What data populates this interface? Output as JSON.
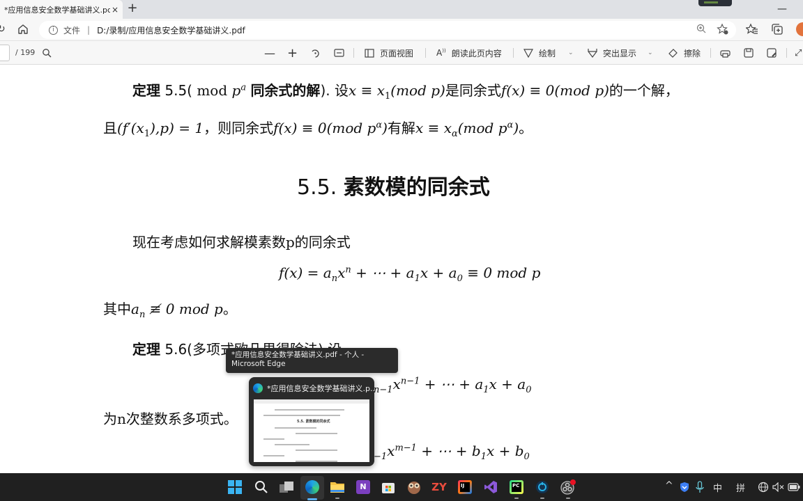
{
  "browser": {
    "tab_title": "*应用信息安全数学基础讲义.pdf",
    "tab_close": "×",
    "new_tab": "+",
    "minimize": "—",
    "address": {
      "scheme_label": "文件",
      "separator": "|",
      "url": "D:/录制/应用信息安全数学基础讲义.pdf"
    }
  },
  "pdf_toolbar": {
    "page_current": "",
    "page_total": "/ 199",
    "page_view": "页面视图",
    "read_aloud": "朗读此页内容",
    "draw": "绘制",
    "highlight": "突出显示",
    "erase": "擦除"
  },
  "document": {
    "theorem55": {
      "label": "定理",
      "number": "5.5(",
      "mod": "mod",
      "p": "p",
      "a": "a",
      "title_rest": "同余式的解",
      "close": ").",
      "line1_a": "设",
      "line1_b": "是同余式",
      "line1_c": "的一个解，",
      "line2_a": "且",
      "line2_b": "，则同余式",
      "line2_c": "有解",
      "line2_d": "。"
    },
    "heading": {
      "number": "5.5.",
      "title": "素数模的同余式"
    },
    "intro": "现在考虑如何求解模素数p的同余式",
    "where_a": "其中",
    "where_b": "。",
    "theorem56": {
      "label": "定理",
      "rest": "5.6(多项式欧几里得除法) 设"
    },
    "poly_desc": "为n次整数系多项式。",
    "math": {
      "eq1": "x ≡ x",
      "sub1": "1",
      "mod_p": "(mod  p)",
      "fx0": "f(x) ≡ 0(mod  p)",
      "gcd": "(f′(x",
      "gcd_rest": "),p) = 1",
      "fx0a": "f(x) ≡ 0(mod  p",
      "alpha": "α",
      "sol": "x ≡ x",
      "sol_mod": "(mod  p",
      "close": ")",
      "display1": "f(x) = a",
      "n": "n",
      "xn": "x",
      "dots": " + ⋯ + a",
      "one": "1",
      "x_plus": "x + a",
      "zero": "0",
      "cong0": " ≡ 0  mod  p",
      "an_ne": "a",
      "ne0": " ≢ 0  mod  p",
      "poly1_a": "n−1",
      "poly1_b": "x",
      "poly1_exp": "n−1",
      "poly1_c": " + ⋯ + a",
      "poly1_d": "x + a",
      "poly2_a": "−1",
      "poly2_b": "x",
      "poly2_exp": "m−1",
      "poly2_c": " + ⋯ + b",
      "poly2_d": "x + b"
    }
  },
  "taskbar": {
    "tooltip": "*应用信息安全数学基础讲义.pdf - 个人 - Microsoft Edge",
    "preview_title": "*应用信息安全数学基础讲义.p...",
    "preview_heading": "5.5. 素数模的同余式",
    "apps": [
      "start",
      "search",
      "task-view",
      "edge",
      "file-explorer",
      "onenote",
      "store",
      "owl-app",
      "zy-app",
      "intellij",
      "visual-studio",
      "pycharm",
      "app-ring",
      "obs"
    ],
    "zy_label": "ZY",
    "ij_label": "IJ",
    "pc_label": "PC",
    "n_label": "N",
    "tray": {
      "chevron": "^",
      "ime_mode": "中",
      "ime_pinyin": "拼"
    }
  }
}
